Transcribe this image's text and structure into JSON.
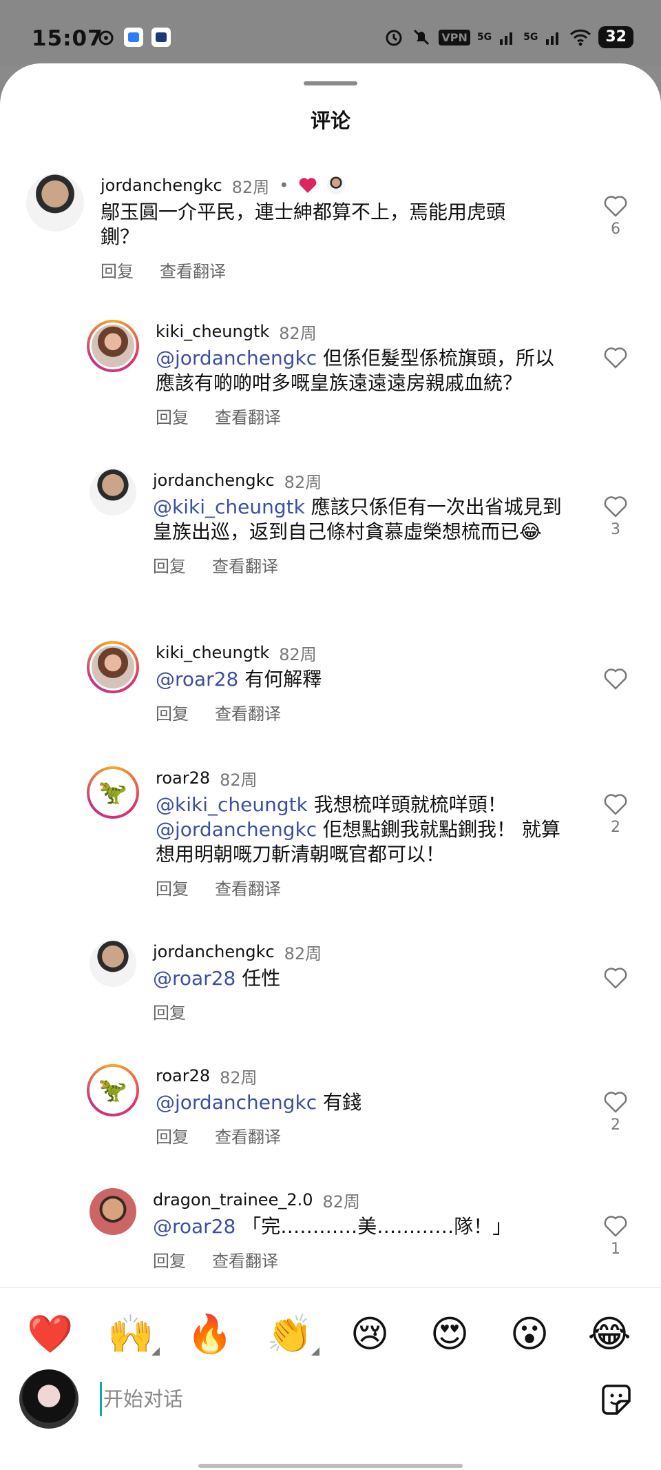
{
  "status": {
    "time": "15:07",
    "vpn": "VPN",
    "net1": "5G",
    "net2": "5G",
    "battery": "32"
  },
  "sheet": {
    "title": "评论"
  },
  "actions": {
    "reply": "回复",
    "translate": "查看翻译"
  },
  "comments": [
    {
      "user": "jordanchengkc",
      "when": "82周",
      "dot": "•",
      "mention": "",
      "text": "鄔玉圓一介平民，連士紳都算不上，焉能用虎頭鍘？",
      "likes": "6"
    },
    {
      "user": "kiki_cheungtk",
      "when": "82周",
      "mention": "@jordanchengkc",
      "text": " 但係佢髮型係梳旗頭，所以應該有啲啲咁多嘅皇族遠遠遠房親戚血統？",
      "likes": ""
    },
    {
      "user": "jordanchengkc",
      "when": "82周",
      "mention": "@kiki_cheungtk",
      "text": " 應該只係佢有一次出省城見到皇族出巡，返到自己條村貪慕虛榮想梳而已😂",
      "likes": "3"
    },
    {
      "user": "kiki_cheungtk",
      "when": "82周",
      "mention": "@roar28",
      "text": " 有何解釋",
      "likes": ""
    },
    {
      "user": "roar28",
      "when": "82周",
      "mention": "@kiki_cheungtk",
      "text": " 我想梳咩頭就梳咩頭！",
      "mention2": "@jordanchengkc",
      "text2": " 佢想點鍘我就點鍘我！ 就算想用明朝嘅刀斬清朝嘅官都可以！",
      "likes": "2"
    },
    {
      "user": "jordanchengkc",
      "when": "82周",
      "mention": "@roar28",
      "text": " 任性",
      "likes": ""
    },
    {
      "user": "roar28",
      "when": "82周",
      "mention": "@jordanchengkc",
      "text": " 有錢",
      "likes": "2"
    },
    {
      "user": "dragon_trainee_2.0",
      "when": "82周",
      "mention": "@roar28",
      "text": " 「完…………美…………隊！」",
      "likes": "1"
    }
  ],
  "emojis": [
    "❤️",
    "🙌",
    "🔥",
    "👏",
    "😢",
    "😍",
    "😮",
    "😂"
  ],
  "composer": {
    "placeholder": "开始对话"
  },
  "colors": {
    "mention": "#3b4fa0",
    "heart": "#e0245e"
  }
}
